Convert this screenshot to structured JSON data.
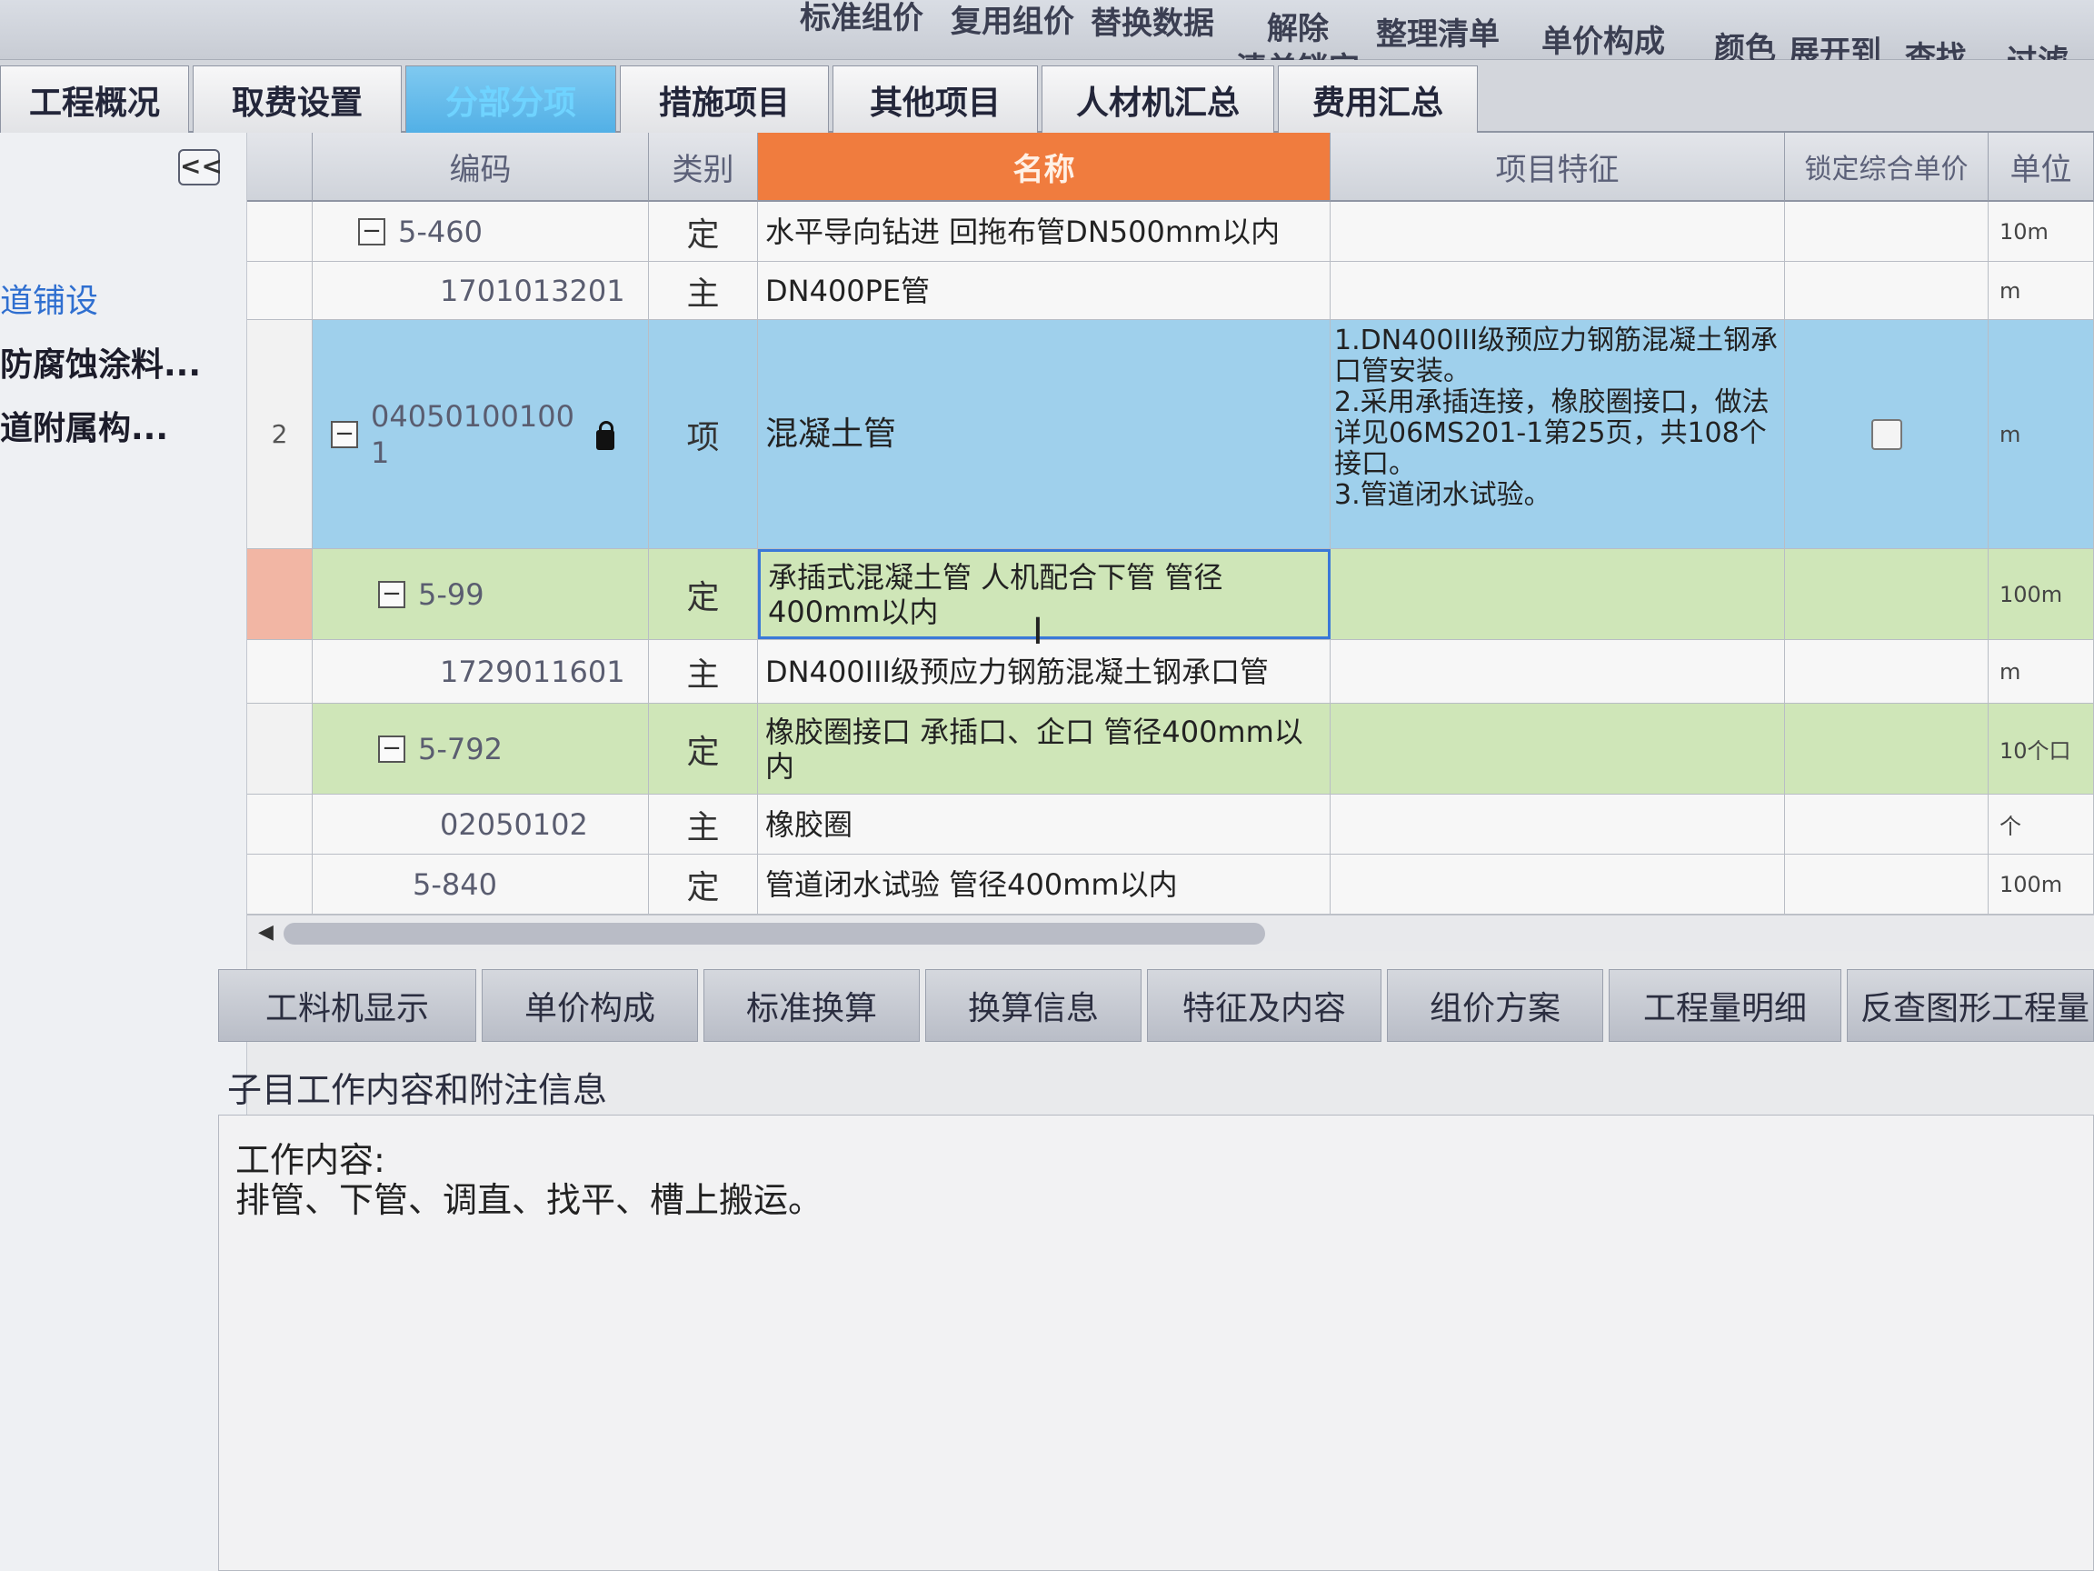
{
  "ribbon": {
    "buttons": [
      "标准组价",
      "复用组价",
      "替换数据",
      "解除",
      "整理清单",
      "单价构成",
      "颜色",
      "展开到",
      "查找",
      "过滤"
    ],
    "sub_label": "清单锁定"
  },
  "tabs": [
    "工程概况",
    "取费设置",
    "分部分项",
    "措施项目",
    "其他项目",
    "人材机汇总",
    "费用汇总"
  ],
  "left_panel": {
    "collapse_label": "<<",
    "items": [
      "道铺设",
      "防腐蚀涂料...",
      "道附属构..."
    ]
  },
  "grid": {
    "headers": {
      "code": "编码",
      "type": "类别",
      "name": "名称",
      "feature": "项目特征",
      "lock_price": "锁定综合单价",
      "unit": "单位"
    },
    "rows": [
      {
        "toggle": "−",
        "code": "5-460",
        "type": "定",
        "name": "水平导向钻进 回拖布管DN500mm以内",
        "feature": "",
        "unit": "10m"
      },
      {
        "code": "1701013201",
        "type": "主",
        "name": "DN400PE管",
        "feature": "",
        "unit": "m"
      },
      {
        "row_no": "2",
        "toggle": "−",
        "code": "04050100100 1",
        "type": "项",
        "name": "混凝土管",
        "feature_lines": [
          "1.DN400III级预应力钢筋混凝土钢承口管安装。",
          "2.采用承插连接，橡胶圈接口，做法详见06MS201-1第25页，共108个接口。",
          "3.管道闭水试验。"
        ],
        "unit": "m"
      },
      {
        "toggle": "−",
        "code": "5-99",
        "type": "定",
        "name": "承插式混凝土管 人机配合下管 管径400mm以内",
        "feature": "",
        "unit": "100m"
      },
      {
        "code": "1729011601",
        "type": "主",
        "name": "DN400III级预应力钢筋混凝土钢承口管",
        "feature": "",
        "unit": "m"
      },
      {
        "toggle": "−",
        "code": "5-792",
        "type": "定",
        "name": "橡胶圈接口 承插口、企口 管径400mm以内",
        "feature": "",
        "unit": "10个口"
      },
      {
        "code": "02050102",
        "type": "主",
        "name": "橡胶圈",
        "feature": "",
        "unit": "个"
      },
      {
        "code": "5-840",
        "type": "定",
        "name": "管道闭水试验 管径400mm以内",
        "feature": "",
        "unit": "100m"
      }
    ]
  },
  "bottom_tabs": [
    "工料机显示",
    "单价构成",
    "标准换算",
    "换算信息",
    "特征及内容",
    "组价方案",
    "工程量明细",
    "反查图形工程量"
  ],
  "detail": {
    "title": "子目工作内容和附注信息",
    "line1": "工作内容:",
    "line2": "排管、下管、调直、找平、槽上搬运。"
  },
  "colors": {
    "active_tab": "#52b0e6",
    "name_header": "#f07c3e",
    "highlight_row": "#9fd0ec",
    "green_row": "#cfe6b8"
  }
}
